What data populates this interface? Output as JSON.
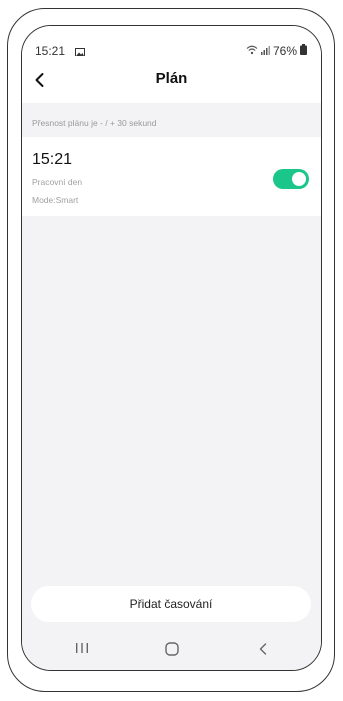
{
  "status_bar": {
    "time": "15:21",
    "battery": "76%",
    "icons": [
      "gallery-icon",
      "wifi-icon",
      "signal-icon",
      "battery-icon"
    ]
  },
  "header": {
    "title": "Plán",
    "back_icon": "chevron-left-icon"
  },
  "accuracy_note": "Přesnost plánu je - / + 30 sekund",
  "schedules": [
    {
      "time": "15:21",
      "days": "Pracovní den",
      "mode": "Mode:Smart",
      "enabled": true
    }
  ],
  "add_button_label": "Přidat časování",
  "nav_bar": {
    "icons": [
      "recent-apps-icon",
      "home-icon",
      "back-icon"
    ]
  },
  "colors": {
    "toggle_on": "#1ac68a",
    "background": "#f3f3f5",
    "card": "#ffffff"
  }
}
